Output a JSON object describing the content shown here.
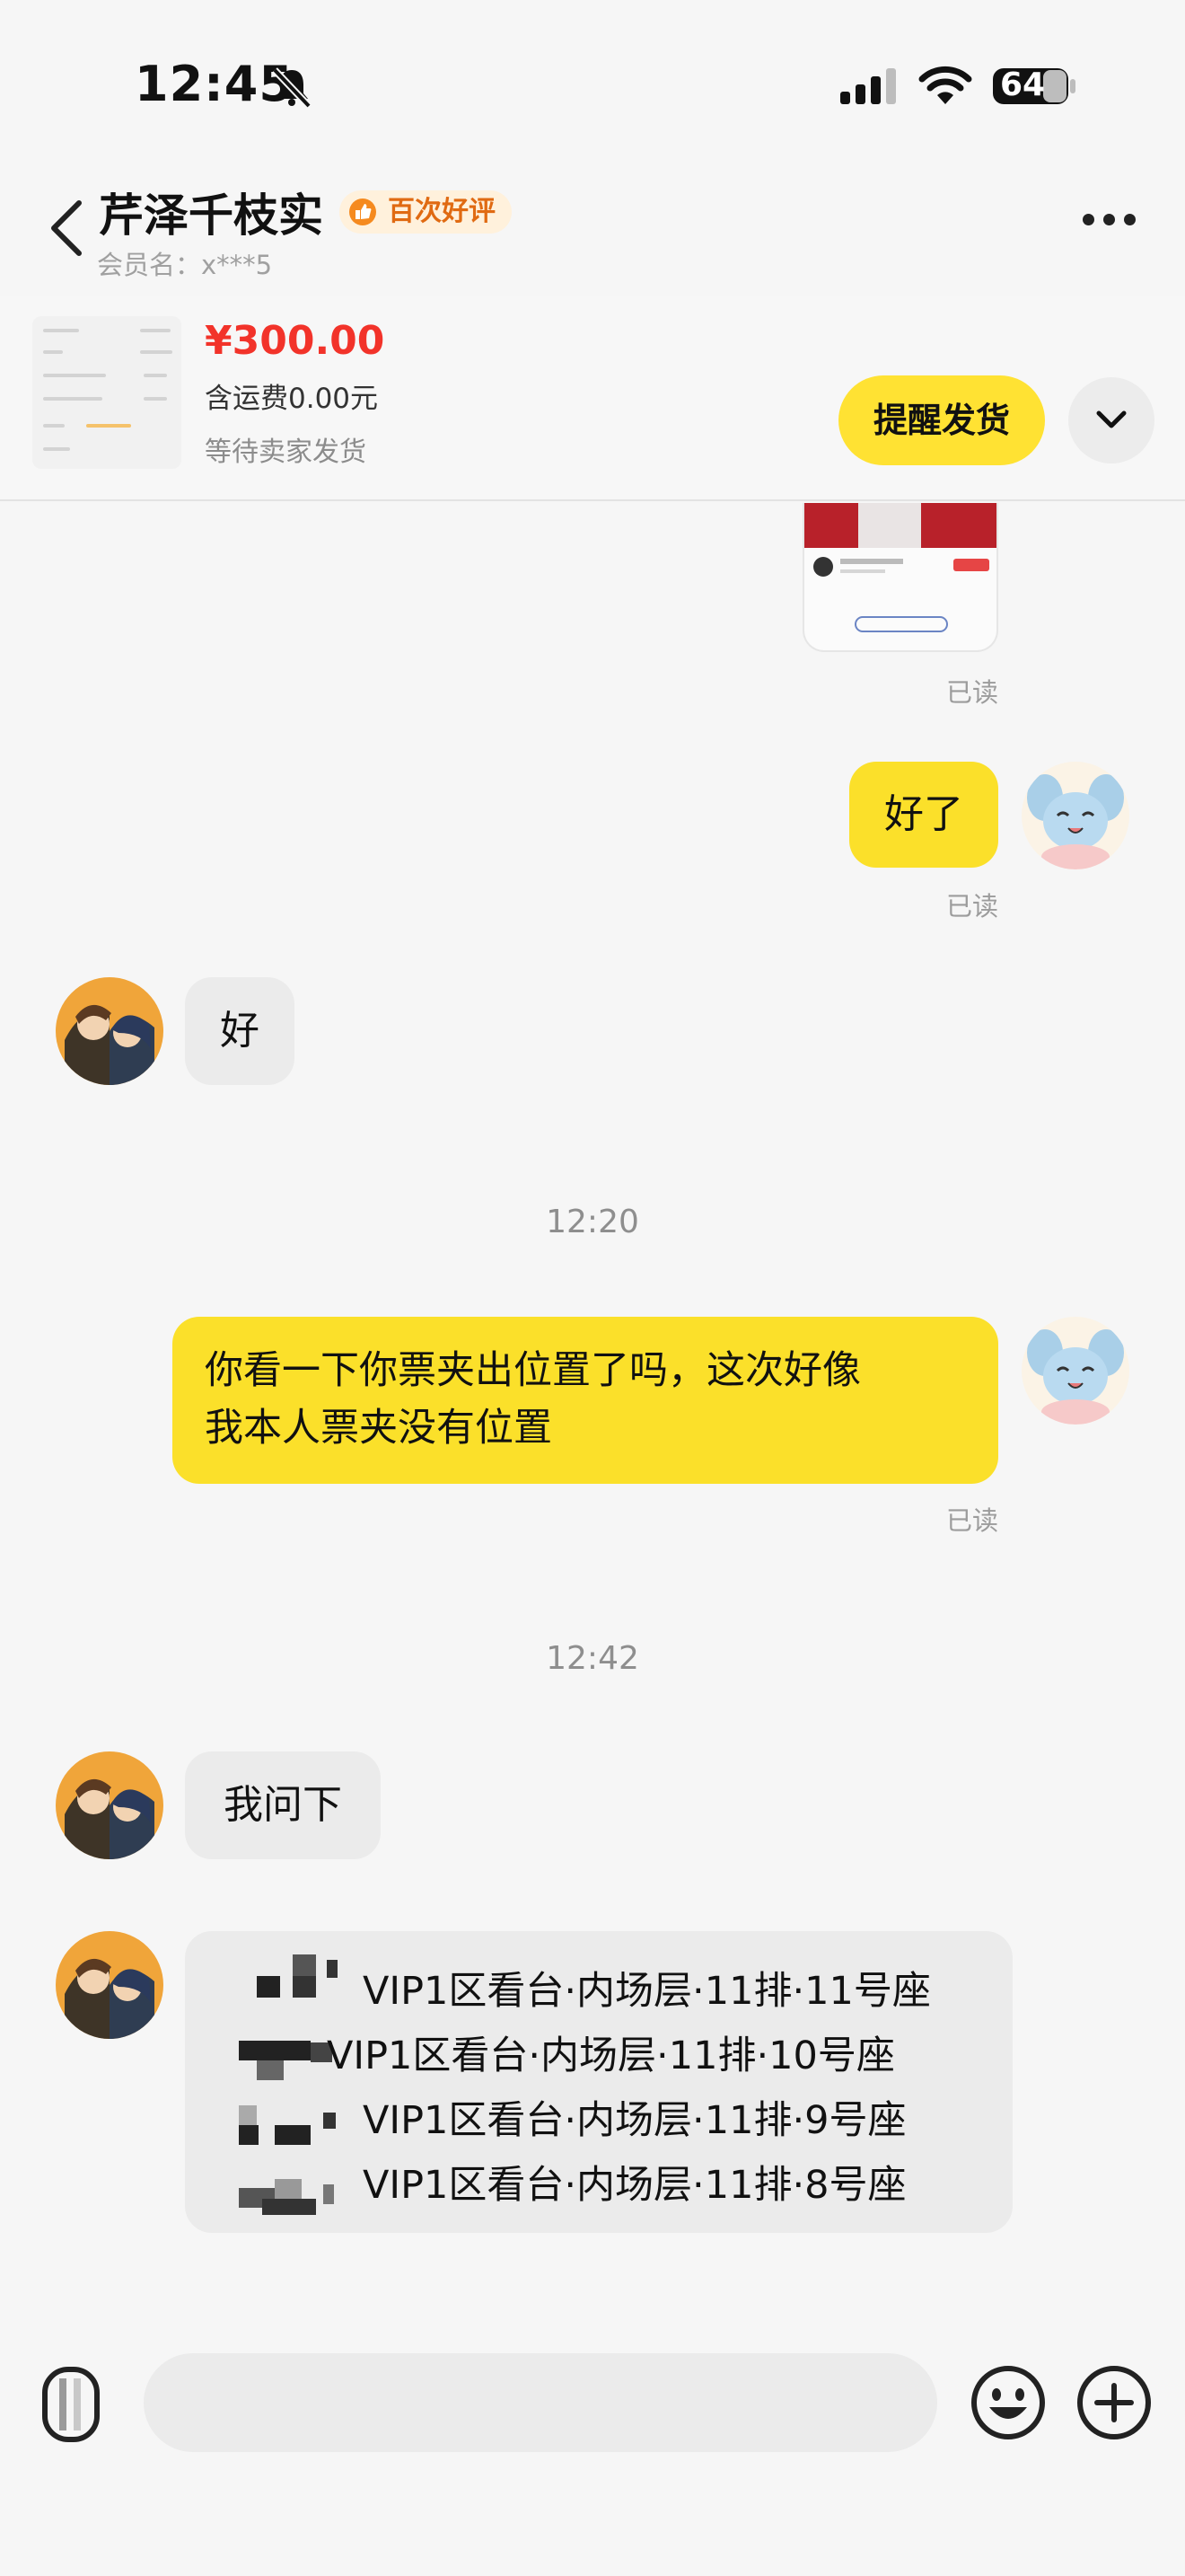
{
  "status_bar": {
    "time": "12:45",
    "battery": "64"
  },
  "header": {
    "title": "芹泽千枝实",
    "badge": "百次好评",
    "member_label": "会员名：x***5"
  },
  "order": {
    "price": "¥300.00",
    "shipping": "含运费0.00元",
    "status": "等待卖家发货",
    "remind_button": "提醒发货"
  },
  "messages": {
    "read_label": "已读",
    "msg1": "好了",
    "msg2": "好",
    "time1": "12:20",
    "msg3": "你看一下你票夹出位置了吗，这次好像\n我本人票夹没有位置",
    "time2": "12:42",
    "msg4": "我问下",
    "tickets": [
      "VIP1区看台·内场层·11排·11号座",
      "VIP1区看台·内场层·11排·10号座",
      "VIP1区看台·内场层·11排·9号座",
      "VIP1区看台·内场层·11排·8号座"
    ]
  },
  "colors": {
    "accent_yellow": "#fbe02a",
    "price_red": "#f2332a",
    "badge_orange": "#e06a12"
  },
  "icons": [
    "back-arrow-icon",
    "mute-bell-icon",
    "signal-icon",
    "wifi-icon",
    "battery-icon",
    "more-icon",
    "chevron-down-icon",
    "voice-icon",
    "emoji-icon",
    "plus-icon"
  ]
}
